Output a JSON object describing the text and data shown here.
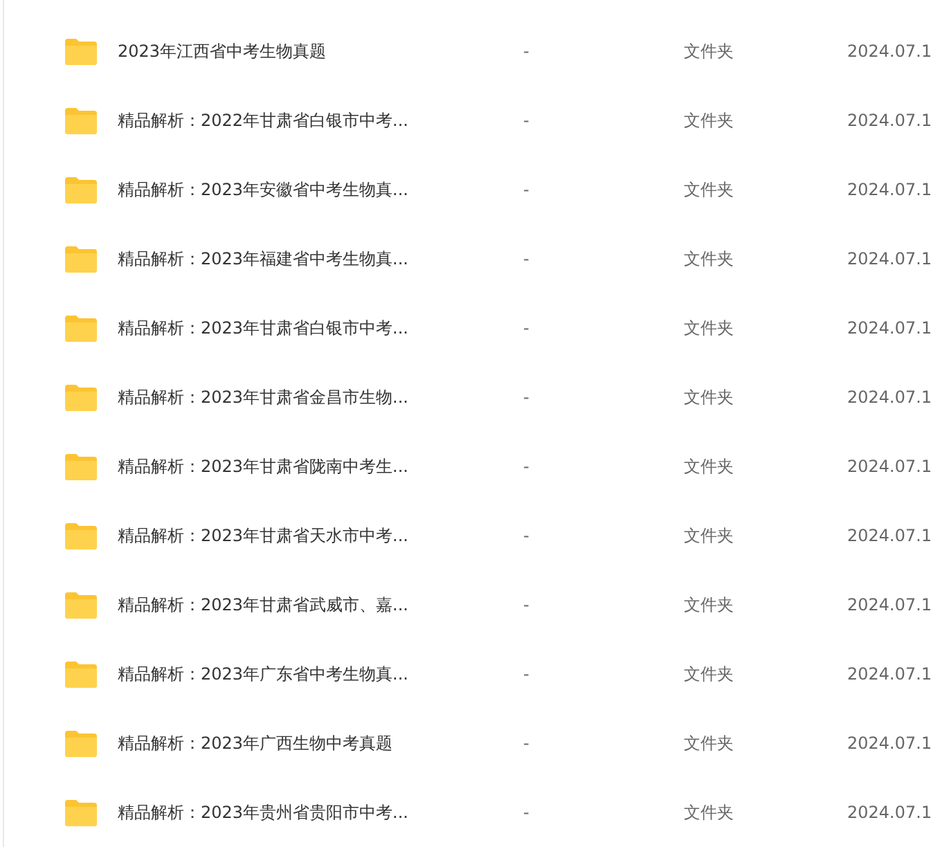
{
  "files": [
    {
      "name": "2023年江西省中考生物真题",
      "size": "-",
      "type": "文件夹",
      "date": "2024.07.1"
    },
    {
      "name": "精品解析：2022年甘肃省白银市中考...",
      "size": "-",
      "type": "文件夹",
      "date": "2024.07.1"
    },
    {
      "name": "精品解析：2023年安徽省中考生物真...",
      "size": "-",
      "type": "文件夹",
      "date": "2024.07.1"
    },
    {
      "name": "精品解析：2023年福建省中考生物真...",
      "size": "-",
      "type": "文件夹",
      "date": "2024.07.1"
    },
    {
      "name": "精品解析：2023年甘肃省白银市中考...",
      "size": "-",
      "type": "文件夹",
      "date": "2024.07.1"
    },
    {
      "name": "精品解析：2023年甘肃省金昌市生物...",
      "size": "-",
      "type": "文件夹",
      "date": "2024.07.1"
    },
    {
      "name": "精品解析：2023年甘肃省陇南中考生...",
      "size": "-",
      "type": "文件夹",
      "date": "2024.07.1"
    },
    {
      "name": "精品解析：2023年甘肃省天水市中考...",
      "size": "-",
      "type": "文件夹",
      "date": "2024.07.1"
    },
    {
      "name": "精品解析：2023年甘肃省武威市、嘉...",
      "size": "-",
      "type": "文件夹",
      "date": "2024.07.1"
    },
    {
      "name": "精品解析：2023年广东省中考生物真...",
      "size": "-",
      "type": "文件夹",
      "date": "2024.07.1"
    },
    {
      "name": "精品解析：2023年广西生物中考真题",
      "size": "-",
      "type": "文件夹",
      "date": "2024.07.1"
    },
    {
      "name": "精品解析：2023年贵州省贵阳市中考...",
      "size": "-",
      "type": "文件夹",
      "date": "2024.07.1"
    }
  ]
}
